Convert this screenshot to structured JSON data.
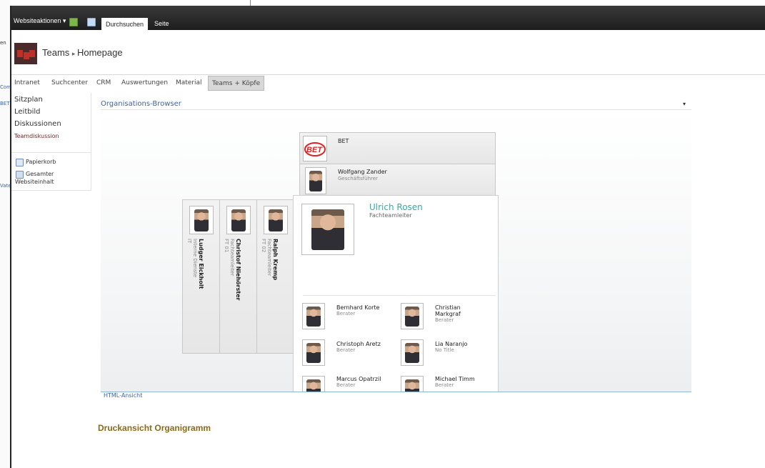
{
  "ribbon": {
    "site_actions": "Websiteaktionen",
    "tabs": [
      "Durchsuchen",
      "Seite"
    ]
  },
  "header": {
    "site_title": "Teams",
    "page": "Homepage"
  },
  "topnav": [
    "Intranet",
    "Suchcenter",
    "CRM",
    "Auswertungen",
    "Material",
    "Teams + Köpfe"
  ],
  "quicklaunch": {
    "items": [
      "Sitzplan",
      "Leitbild",
      "Diskussionen"
    ],
    "sub": "Teamdiskussion",
    "recycle": "Papierkorb",
    "all_content_1": "Gesamter",
    "all_content_2": "Websiteinhalt"
  },
  "orgbrowser": {
    "title": "Organisations-Browser",
    "root": {
      "name": "BET"
    },
    "manager": {
      "name": "Wolfgang Zander",
      "title": "Geschäftsführer"
    },
    "peers": [
      {
        "name": "Ludger Eickholt",
        "title": "Interne Dienste",
        "dept": "IT"
      },
      {
        "name": "Christof Niehörster",
        "title": "Fachteamleiter",
        "dept": "FT 01"
      },
      {
        "name": "Ralph Kremp",
        "title": "Fachteamleiter",
        "dept": "FT 02"
      }
    ],
    "focus": {
      "name": "Ulrich Rosen",
      "title": "Fachteamleiter"
    },
    "reports": [
      {
        "name": "Bernhard Korte",
        "title": "Berater"
      },
      {
        "name": "Christian Markgraf",
        "title": "Berater"
      },
      {
        "name": "Christoph Aretz",
        "title": "Berater"
      },
      {
        "name": "Lia Naranjo",
        "title": "No Title"
      },
      {
        "name": "Marcus Opatrzil",
        "title": "Berater"
      },
      {
        "name": "Michael Timm",
        "title": "Berater"
      }
    ],
    "html_view": "HTML-Ansicht"
  },
  "print_link": "Druckansicht Organigramm",
  "colors": {
    "focus_name": "#2ab0a8",
    "link": "#3b63b0",
    "print": "#8a6a16"
  },
  "icons": [
    "new-document-icon",
    "edit-icon",
    "recycle-bin-icon",
    "site-content-icon",
    "dropdown-arrow-icon",
    "site-logo"
  ]
}
